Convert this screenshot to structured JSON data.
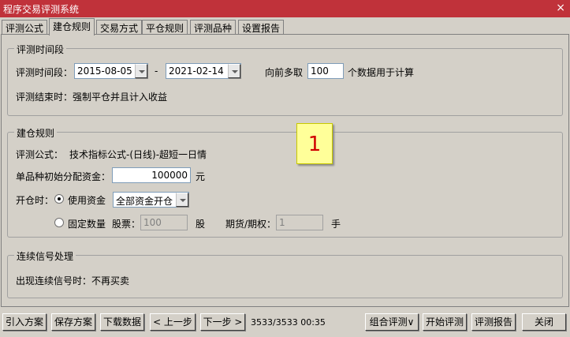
{
  "window": {
    "title": "程序交易评测系统",
    "close": "×"
  },
  "tabs": [
    "评测公式",
    "建仓规则",
    "交易方式",
    "平仓规则",
    "评测品种",
    "设置报告"
  ],
  "period": {
    "legend": "评测时间段",
    "label": "评测时间段：",
    "start": "2015-08-05",
    "dash": "-",
    "end": "2021-02-14",
    "lookback_prefix": "向前多取",
    "lookback_value": "100",
    "lookback_suffix": "个数据用于计算",
    "end_rule": "评测结束时：强制平仓并且计入收益"
  },
  "build": {
    "legend": "建仓规则",
    "formula_label": "评测公式：",
    "formula_value": "技术指标公式-(日线)-超短一日情",
    "capital_label": "单品种初始分配资金：",
    "capital_value": "100000",
    "capital_unit": "元",
    "open_label": "开仓时：",
    "use_capital": "使用资金",
    "capital_mode": "全部资金开仓",
    "fixed_qty": "固定数量",
    "stock_label": "股票：",
    "stock_value": "100",
    "stock_unit": "股",
    "futures_label": "期货/期权：",
    "futures_value": "1",
    "futures_unit": "手"
  },
  "signal": {
    "legend": "连续信号处理",
    "text": "出现连续信号时：不再买卖"
  },
  "badge": "1",
  "footer": {
    "import": "引入方案",
    "save": "保存方案",
    "download": "下载数据",
    "prev": "< 上一步",
    "next": "下一步 >",
    "status": "3533/3533 00:35",
    "combo": "组合评测∨",
    "start": "开始评测",
    "report": "评测报告",
    "close": "关闭"
  }
}
